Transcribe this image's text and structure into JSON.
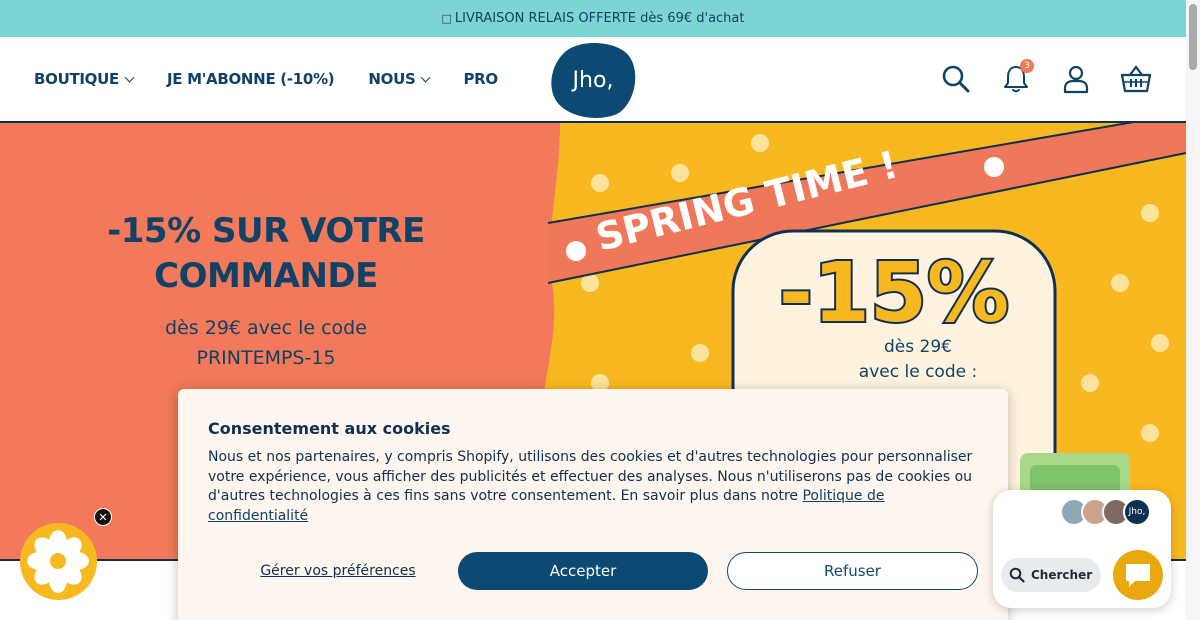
{
  "announcement": {
    "icon": "gift-icon",
    "text": "LIVRAISON RELAIS OFFERTE dès 69€ d'achat"
  },
  "nav": {
    "items": [
      {
        "label": "BOUTIQUE",
        "dropdown": true
      },
      {
        "label": "JE M'ABONNE (-10%)",
        "dropdown": false
      },
      {
        "label": "NOUS",
        "dropdown": true
      },
      {
        "label": "PRO",
        "dropdown": false
      }
    ]
  },
  "logo": {
    "text": "Jho,"
  },
  "header_icons": {
    "search": "search-icon",
    "notifications": "bell-icon",
    "notification_count": "3",
    "account": "user-icon",
    "cart": "basket-icon"
  },
  "hero": {
    "title_line1": "-15% SUR VOTRE",
    "title_line2": "COMMANDE",
    "subtitle_line1": "dès 29€ avec le code",
    "subtitle_line2": "PRINTEMPS-15",
    "banner_text": "SPRING TIME !",
    "big_discount": "-15%",
    "promo_line1": "dès 29€",
    "promo_line2": "avec le code :",
    "colors": {
      "left_bg": "#f2795a",
      "right_bg": "#f8b820",
      "navy": "#0f4266"
    }
  },
  "cookie": {
    "title": "Consentement aux cookies",
    "text": "Nous et nos partenaires, y compris Shopify, utilisons des cookies et d'autres technologies pour personnaliser votre expérience, vous afficher des publicités et effectuer des analyses. Nous n'utiliserons pas de cookies ou d'autres technologies à ces fins sans votre consentement. En savoir plus dans notre ",
    "link_text": "Politique de confidentialité",
    "prefs_label": "Gérer vos préférences",
    "accept_label": "Accepter",
    "refuse_label": "Refuser"
  },
  "chat": {
    "search_label": "Chercher",
    "avatar_brand": "Jho,"
  }
}
